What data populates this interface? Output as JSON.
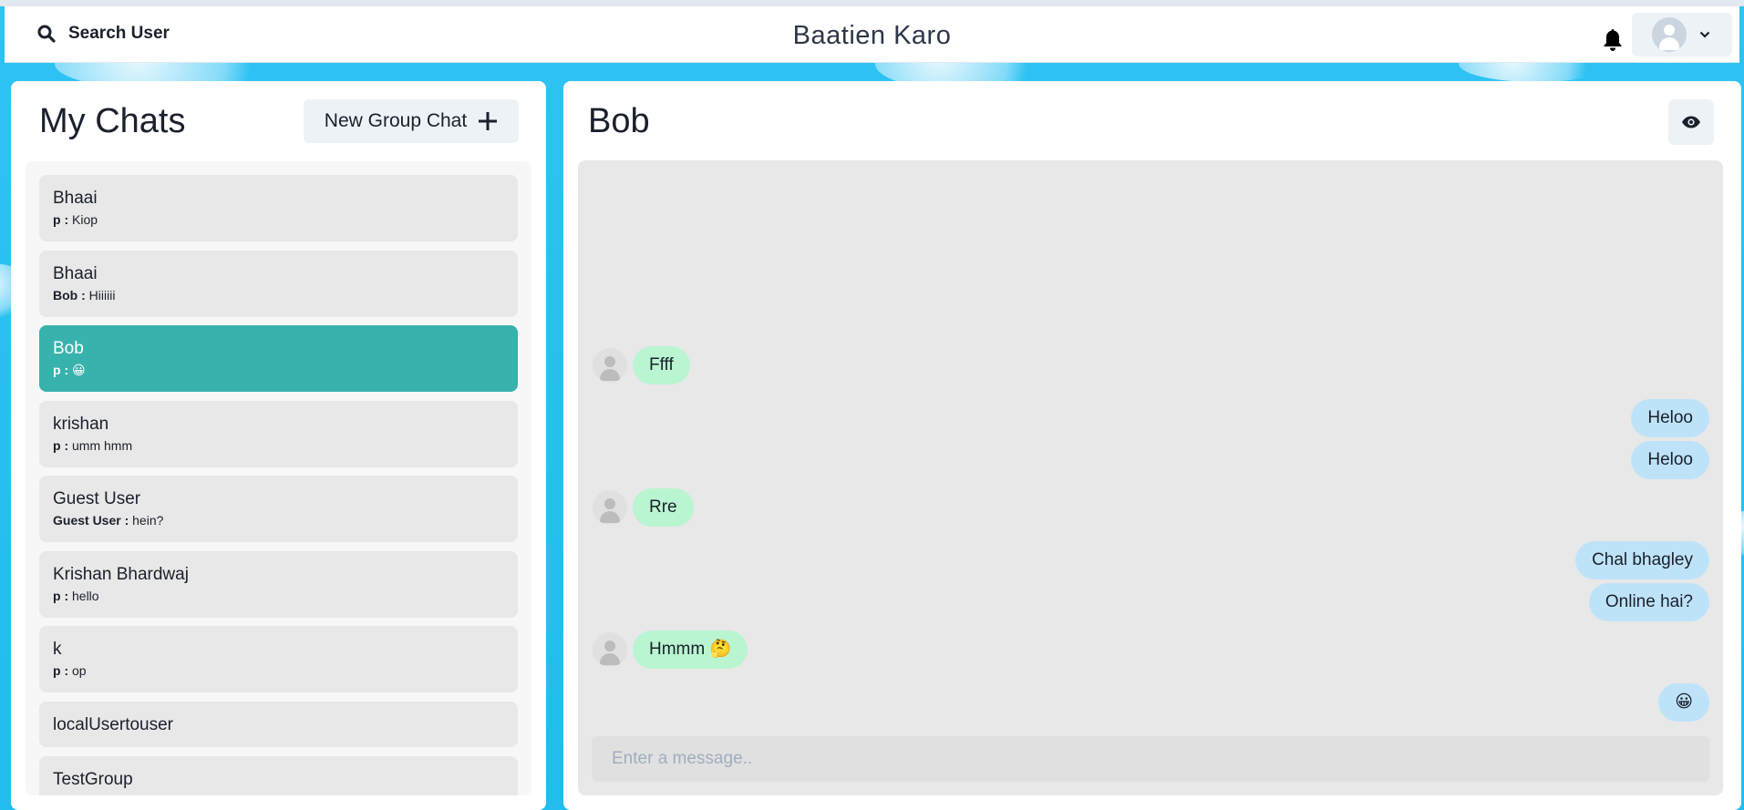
{
  "header": {
    "search_label": "Search User",
    "app_title": "Baatien Karo",
    "icons": {
      "search": "search-icon",
      "bell": "bell-icon",
      "avatar": "user-avatar-icon",
      "chevron": "chevron-down-icon"
    }
  },
  "sidebar": {
    "title": "My Chats",
    "new_group_label": "New Group Chat",
    "new_group_icon": "plus-icon",
    "chats": [
      {
        "name": "Bhaai",
        "sender": "p :",
        "message": "Kiop",
        "active": false
      },
      {
        "name": "Bhaai",
        "sender": "Bob :",
        "message": "Hiiiiii",
        "active": false
      },
      {
        "name": "Bob",
        "sender": "p :",
        "message": "😀",
        "active": true
      },
      {
        "name": "krishan",
        "sender": "p :",
        "message": "umm hmm",
        "active": false
      },
      {
        "name": "Guest User",
        "sender": "Guest User :",
        "message": "hein?",
        "active": false
      },
      {
        "name": "Krishan Bhardwaj",
        "sender": "p :",
        "message": "hello",
        "active": false
      },
      {
        "name": "k",
        "sender": "p :",
        "message": "op",
        "active": false
      },
      {
        "name": "localUsertouser",
        "sender": "",
        "message": "",
        "active": false
      },
      {
        "name": "TestGroup",
        "sender": "",
        "message": "",
        "active": false
      }
    ]
  },
  "chat": {
    "title": "Bob",
    "eye_icon": "eye-icon",
    "messages": [
      {
        "text": "Ffff",
        "direction": "in"
      },
      {
        "text": "Heloo",
        "direction": "out"
      },
      {
        "text": "Heloo",
        "direction": "out"
      },
      {
        "text": "Rre",
        "direction": "in"
      },
      {
        "text": "Chal bhagley",
        "direction": "out"
      },
      {
        "text": "Online hai?",
        "direction": "out"
      },
      {
        "text": "Hmmm 🤔",
        "direction": "in"
      },
      {
        "text": "😀",
        "direction": "out"
      }
    ],
    "input_placeholder": "Enter a message..",
    "input_value": ""
  },
  "colors": {
    "accent_active": "#38b2ac",
    "incoming_bubble": "#b9f5d0",
    "outgoing_bubble": "#bee3f8",
    "background": "#29c0f2"
  }
}
